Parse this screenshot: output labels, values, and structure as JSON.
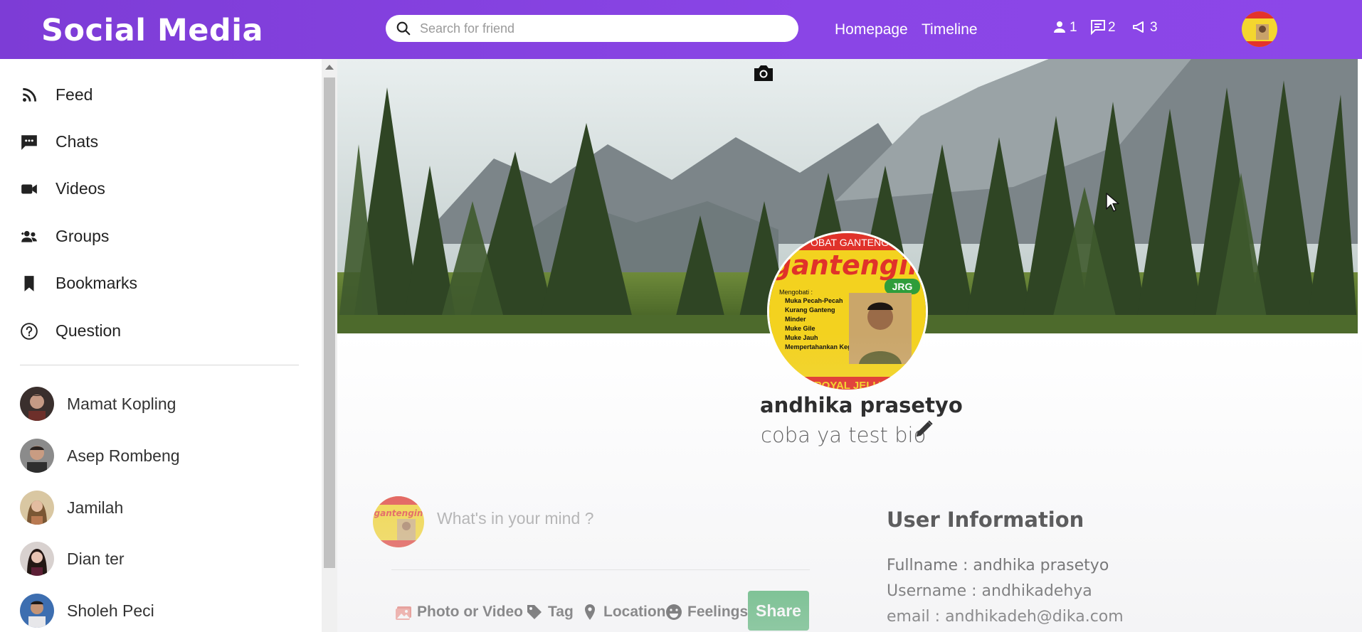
{
  "app": {
    "title": "Social Media"
  },
  "search": {
    "placeholder": "Search for friend"
  },
  "nav": {
    "homepage": "Homepage",
    "timeline": "Timeline"
  },
  "badges": {
    "friends": "1",
    "messages": "2",
    "notifications": "3"
  },
  "sidebar": {
    "items": [
      {
        "label": "Feed",
        "icon": "rss-icon"
      },
      {
        "label": "Chats",
        "icon": "chat-icon"
      },
      {
        "label": "Videos",
        "icon": "video-icon"
      },
      {
        "label": "Groups",
        "icon": "group-icon"
      },
      {
        "label": "Bookmarks",
        "icon": "bookmark-icon"
      },
      {
        "label": "Question",
        "icon": "question-icon"
      }
    ],
    "friends": [
      {
        "name": "Mamat Kopling"
      },
      {
        "name": "Asep Rombeng"
      },
      {
        "name": "Jamilah"
      },
      {
        "name": "Dian ter"
      },
      {
        "name": "Sholeh Peci"
      }
    ]
  },
  "profile": {
    "name": "andhika prasetyo",
    "bio": "coba ya test bio",
    "pic_text": {
      "top": "OBAT GANTENG",
      "brand": "gantengin",
      "badge": "JRG",
      "heading": "Mengobati :",
      "lines": [
        "Muka Pecah-Pecah",
        "Kurang Ganteng",
        "Minder",
        "Muke Gile",
        "Muke Jauh",
        "Mempertahankan Kegantengan"
      ],
      "bottom": "ROYAL JELLY"
    }
  },
  "post": {
    "placeholder": "What's in your mind ?",
    "actions": {
      "photo": "Photo or Video",
      "tag": "Tag",
      "location": "Location",
      "feelings": "Feelings"
    },
    "share_label": "Share"
  },
  "user_info": {
    "title": "User Information",
    "fullname": "Fullname : andhika prasetyo",
    "username": "Username : andhikadehya",
    "email": "email : andhikadeh@dika.com"
  },
  "colors": {
    "accent": "#8a45e6",
    "share": "#1f9e48"
  }
}
